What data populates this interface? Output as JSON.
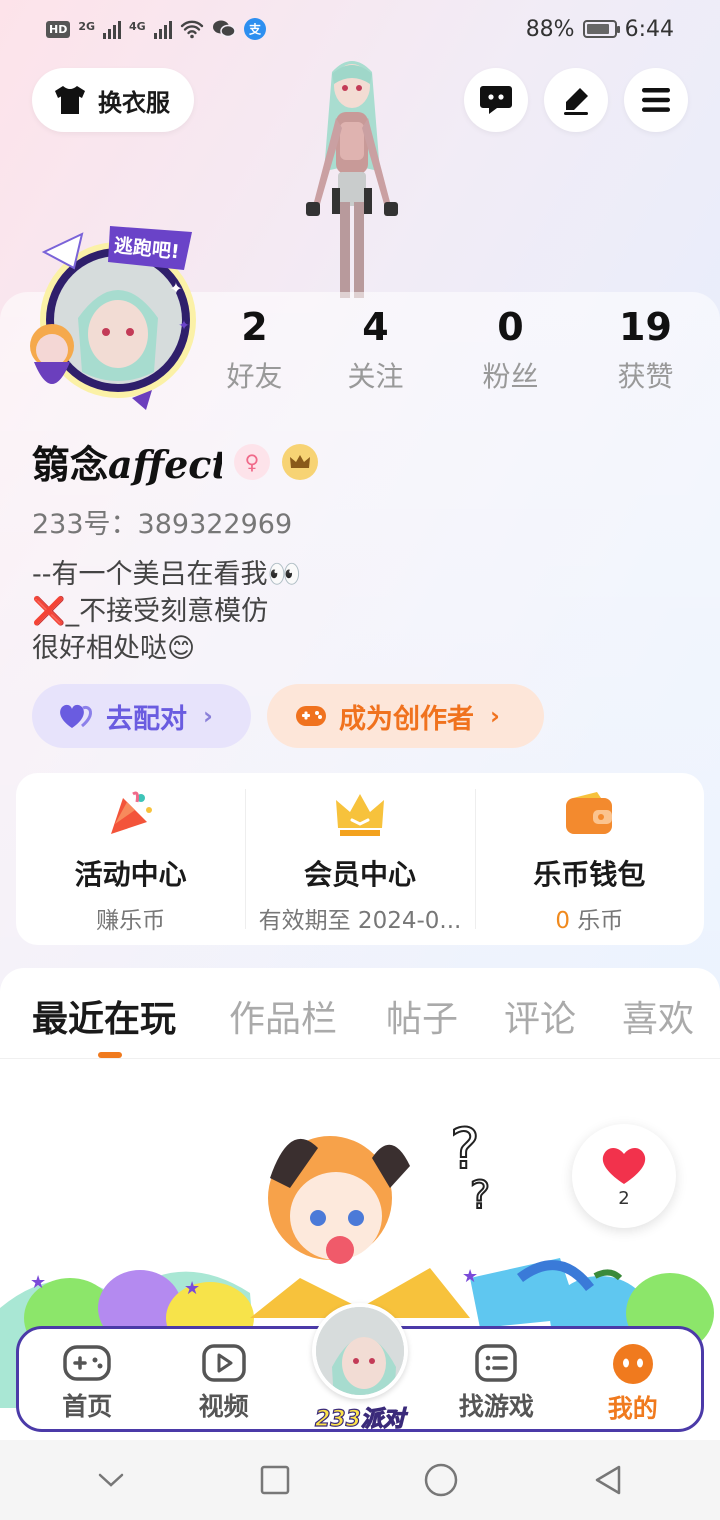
{
  "status_bar": {
    "network_badge": "HD",
    "net1": "2G",
    "net2": "4G",
    "battery": "88%",
    "battery_level": 0.88,
    "time": "6:44"
  },
  "header": {
    "outfit_label": "换衣服"
  },
  "profile": {
    "avatar_badge": "逃跑吧!",
    "stats": [
      {
        "num": "2",
        "label": "好友"
      },
      {
        "num": "4",
        "label": "关注"
      },
      {
        "num": "0",
        "label": "粉丝"
      },
      {
        "num": "19",
        "label": "获赞"
      }
    ],
    "username_cn": "篛念",
    "username_latin": "affecti",
    "gender_symbol": "♀",
    "user_id": "233号：389322969",
    "bio": {
      "line1": "--有一个美吕在看我👀",
      "line2": "❌_不接受刻意模仿",
      "line3": "很好相处哒😊"
    },
    "match_label": "去配对",
    "creator_label": "成为创作者"
  },
  "services": [
    {
      "title": "活动中心",
      "sub": "赚乐币"
    },
    {
      "title": "会员中心",
      "sub": "有效期至 2024-0..."
    },
    {
      "title": "乐币钱包",
      "count": "0",
      "unit": " 乐币"
    }
  ],
  "tabs": [
    "最近在玩",
    "作品栏",
    "帖子",
    "评论",
    "喜欢"
  ],
  "like_count": "2",
  "bottom_nav": {
    "home": "首页",
    "video": "视频",
    "party": "233派对",
    "games": "找游戏",
    "mine": "我的"
  },
  "colors": {
    "accent": "#f07a1e",
    "match": "#6a5ce0",
    "nav_border": "#4b3aa8"
  }
}
